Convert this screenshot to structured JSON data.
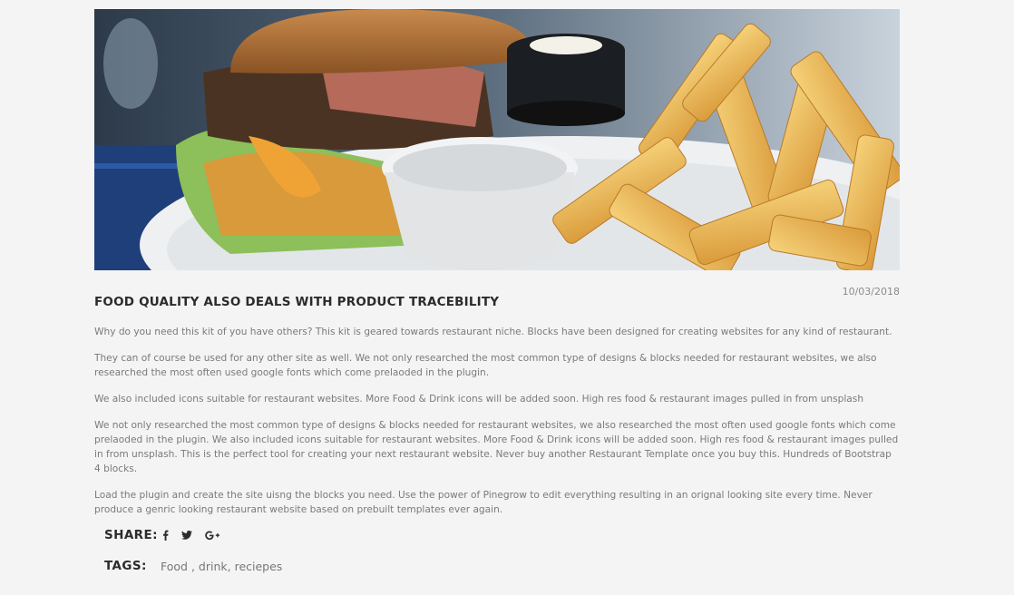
{
  "post": {
    "date": "10/03/2018",
    "title": "FOOD QUALITY ALSO DEALS WITH PRODUCT TRACEBILITY",
    "paragraphs": [
      "Why do you need this kit of you have others? This kit is geared towards restaurant niche. Blocks have been designed for creating websites for any kind of restaurant.",
      "They can of course be used for any other site as well. We not only researched the most common type of designs & blocks needed for restaurant websites, we also researched the most often used google fonts which come prelaoded in the plugin.",
      "We also included icons suitable for restaurant websites. More Food & Drink icons will be added soon. High res food & restaurant images pulled in from unsplash",
      "We not only researched the most common type of designs & blocks needed for restaurant websites, we also researched the most often used google fonts which come prelaoded in the plugin. We also included icons suitable for restaurant websites. More Food & Drink icons will be added soon. High res food & restaurant images pulled in from unsplash. This is the perfect tool for creating your next restaurant website. Never buy another Restaurant Template once you buy this. Hundreds of Bootstrap 4 blocks.",
      "Load the plugin and create the site uisng the blocks you need. Use the power of Pinegrow to edit everything resulting in an orignal looking site every time. Never produce a genric looking restaurant website based on prebuilt templates ever again."
    ]
  },
  "share": {
    "label": "SHARE:",
    "icons": [
      "facebook-icon",
      "twitter-icon",
      "google-plus-icon"
    ]
  },
  "tags": {
    "label": "TAGS:",
    "items": [
      "Food",
      "drink",
      "reciepes"
    ],
    "sep1": " , ",
    "sep2": ", "
  },
  "colors": {
    "background": "#f4f4f4",
    "title": "#2b2b2b",
    "body_text": "#7a7a7a"
  }
}
